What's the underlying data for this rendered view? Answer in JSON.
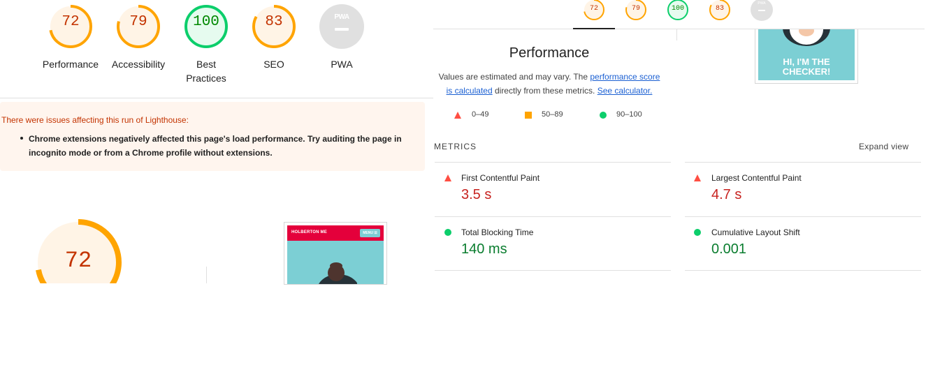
{
  "colors": {
    "orange": "#ffa400",
    "orange_bg": "#fff4e6",
    "orange_text": "#c33300",
    "green": "#0cce6b",
    "green_bg": "#e6fbef",
    "green_text": "#008800",
    "gray": "#cccccc",
    "red": "#ff4e42",
    "link": "#1a5fd2"
  },
  "scores": [
    {
      "label": "Performance",
      "value": "72",
      "score": 72,
      "rating": "average"
    },
    {
      "label": "Accessibility",
      "value": "79",
      "score": 79,
      "rating": "average"
    },
    {
      "label": "Best Practices",
      "label_line1": "Best",
      "label_line2": "Practices",
      "value": "100",
      "score": 100,
      "rating": "pass"
    },
    {
      "label": "SEO",
      "value": "83",
      "score": 83,
      "rating": "average"
    },
    {
      "label": "PWA",
      "badge": "PWA",
      "rating": "na"
    }
  ],
  "warning": {
    "title": "There were issues affecting this run of Lighthouse:",
    "items": [
      "Chrome extensions negatively affected this page's load performance. Try auditing the page in incognito mode or from a Chrome profile without extensions."
    ]
  },
  "big_gauge": {
    "value": "72",
    "score": 72
  },
  "thumbnail": {
    "brand": "HOLBERTON ME",
    "menu": "MENU ☰",
    "hero_text_line1": "HI, I'M THE",
    "hero_text_line2": "CHECKER!"
  },
  "right_tabs": [
    {
      "value": "72",
      "score": 72,
      "rating": "average"
    },
    {
      "value": "79",
      "score": 79,
      "rating": "average"
    },
    {
      "value": "100",
      "score": 100,
      "rating": "pass"
    },
    {
      "value": "83",
      "score": 83,
      "rating": "average"
    },
    {
      "badge": "PWA",
      "rating": "na"
    }
  ],
  "performance": {
    "title": "Performance",
    "desc_prefix": "Values are estimated and may vary. The ",
    "link1": "performance score is calculated",
    "desc_middle": " directly from these metrics. ",
    "link2": "See calculator."
  },
  "legend": [
    {
      "range": "0–49",
      "shape": "triangle"
    },
    {
      "range": "50–89",
      "shape": "square"
    },
    {
      "range": "90–100",
      "shape": "circle"
    }
  ],
  "metrics": {
    "header": "METRICS",
    "expand": "Expand view",
    "items": [
      {
        "name": "First Contentful Paint",
        "value": "3.5 s",
        "rating": "fail"
      },
      {
        "name": "Largest Contentful Paint",
        "value": "4.7 s",
        "rating": "fail"
      },
      {
        "name": "Total Blocking Time",
        "value": "140 ms",
        "rating": "pass"
      },
      {
        "name": "Cumulative Layout Shift",
        "value": "0.001",
        "rating": "pass"
      }
    ]
  }
}
